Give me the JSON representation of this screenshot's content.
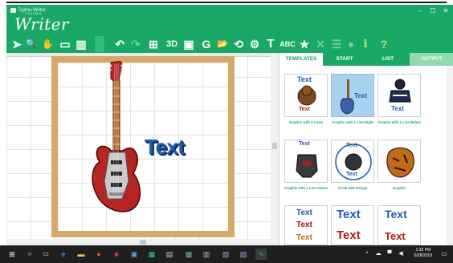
{
  "window": {
    "title": "Tajima Writer",
    "logo_small": "TAJIMA",
    "logo": "Writer",
    "controls": {
      "minimize": "–",
      "maximize": "☐",
      "close": "✕"
    }
  },
  "toolbar": {
    "items": [
      {
        "name": "pointer",
        "glyph": "➤"
      },
      {
        "name": "zoom",
        "glyph": "🔍"
      },
      {
        "name": "pan",
        "glyph": "✋"
      },
      {
        "name": "view",
        "glyph": "▭"
      },
      {
        "name": "layout",
        "glyph": "▥"
      },
      {
        "name": "undo",
        "glyph": "↶"
      },
      {
        "name": "redo",
        "glyph": "↷"
      },
      {
        "name": "grid",
        "glyph": "⊞"
      },
      {
        "name": "3d",
        "glyph": "3D"
      },
      {
        "name": "frame",
        "glyph": "▣"
      },
      {
        "name": "new",
        "glyph": "G"
      },
      {
        "name": "open",
        "glyph": "📂"
      },
      {
        "name": "refresh",
        "glyph": "⟲"
      },
      {
        "name": "settings",
        "glyph": "⚙"
      },
      {
        "name": "text",
        "glyph": "T"
      },
      {
        "name": "abc",
        "glyph": "ABC"
      },
      {
        "name": "star",
        "glyph": "★"
      },
      {
        "name": "delete",
        "glyph": "✕"
      },
      {
        "name": "list",
        "glyph": "☰"
      },
      {
        "name": "circle",
        "glyph": "●"
      },
      {
        "name": "info",
        "glyph": "i"
      },
      {
        "name": "help",
        "glyph": "?"
      }
    ]
  },
  "design": {
    "text": "Text"
  },
  "panel": {
    "tabs": [
      "TEMPLATES",
      "START",
      "LIST",
      "OUTPUT"
    ],
    "active_tab": "TEMPLATES",
    "cards": [
      {
        "label": "Graphic with 2 Lines",
        "thumb_top": "Text",
        "thumb_bottom": "Text"
      },
      {
        "label": "Graphic with 1 Line Right",
        "thumb_top": "",
        "thumb_bottom": "Text"
      },
      {
        "label": "Graphic with 1 Line Below",
        "thumb_top": "",
        "thumb_bottom": "Text"
      },
      {
        "label": "Graphic with 1 Line Above",
        "thumb_top": "Text",
        "thumb_bottom": ""
      },
      {
        "label": "Circle with Design",
        "thumb_top": "Text",
        "thumb_bottom": "Text"
      },
      {
        "label": "Graphic",
        "thumb_top": "",
        "thumb_bottom": ""
      },
      {
        "label": "",
        "thumb_top": "Text",
        "thumb_bottom": "Text"
      },
      {
        "label": "",
        "thumb_top": "Text",
        "thumb_bottom": "Text"
      },
      {
        "label": "",
        "thumb_top": "Text",
        "thumb_bottom": "Text"
      }
    ]
  },
  "taskbar": {
    "time": "1:32 PM",
    "date": "6/28/2018"
  },
  "colors": {
    "accent": "#1aa867",
    "hoop": "#d5a969",
    "text_blue": "#1f5ba8",
    "guitar_red": "#b62424"
  }
}
